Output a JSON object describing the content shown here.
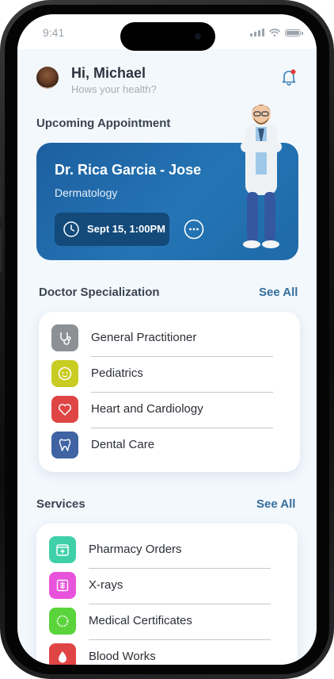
{
  "status_bar": {
    "time": "9:41"
  },
  "header": {
    "greeting": "Hi, Michael",
    "subtitle": "Hows your health?"
  },
  "appointment": {
    "section_title": "Upcoming Appointment",
    "doctor_name": "Dr. Rica Garcia - Jose",
    "specialty": "Dermatology",
    "datetime": "Sept 15, 1:00PM"
  },
  "specialization": {
    "section_title": "Doctor Specialization",
    "see_all": "See All",
    "items": [
      {
        "label": "General Practitioner",
        "color": "#8d9196",
        "icon": "stethoscope-icon"
      },
      {
        "label": "Pediatrics",
        "color": "#c9cc22",
        "icon": "baby-face-icon"
      },
      {
        "label": "Heart and Cardiology",
        "color": "#e04545",
        "icon": "heart-icon"
      },
      {
        "label": "Dental Care",
        "color": "#3f63a3",
        "icon": "tooth-icon"
      }
    ]
  },
  "services": {
    "section_title": "Services",
    "see_all": "See All",
    "items": [
      {
        "label": "Pharmacy Orders",
        "color": "#3fd0a9",
        "icon": "medicine-box-icon"
      },
      {
        "label": "X-rays",
        "color": "#e853dc",
        "icon": "xray-icon"
      },
      {
        "label": "Medical Certificates",
        "color": "#5ad43a",
        "icon": "certificate-badge-icon"
      },
      {
        "label": "Blood Works",
        "color": "#e04545",
        "icon": "blood-drop-icon"
      }
    ]
  },
  "colors": {
    "accent": "#356e9a",
    "card_blue": "#2474b4",
    "notification_dot": "#e53935"
  }
}
